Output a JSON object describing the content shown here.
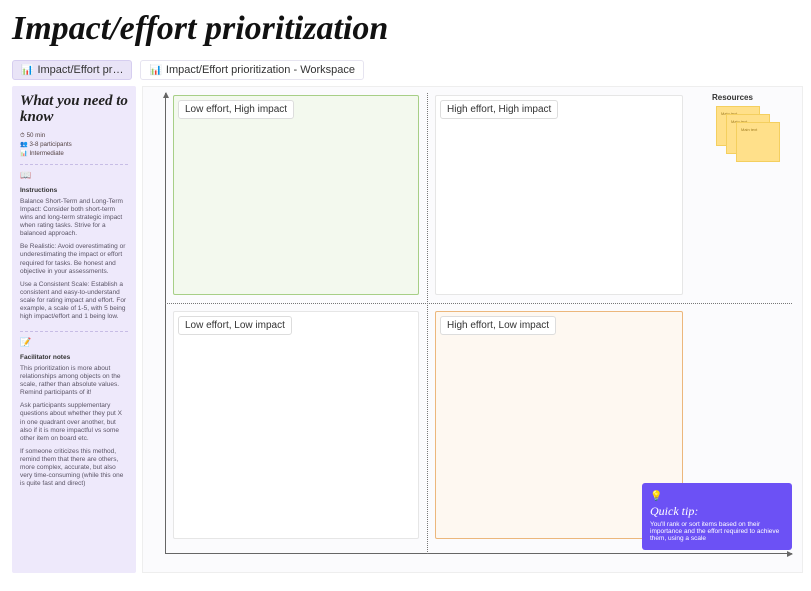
{
  "title": "Impact/effort prioritization",
  "tabs": {
    "short": "Impact/Effort pr…",
    "full": "Impact/Effort prioritization - Workspace"
  },
  "sidebar": {
    "heading": "What you need to know",
    "meta": {
      "duration": "50 min",
      "participants": "3-8 participants",
      "level": "Intermediate"
    },
    "icons": {
      "instructions": "📖",
      "facilitator": "📝"
    },
    "instructions_label": "Instructions",
    "instructions": [
      "Balance Short-Term and Long-Term Impact: Consider both short-term wins and long-term strategic impact when rating tasks. Strive for a balanced approach.",
      "Be Realistic: Avoid overestimating or underestimating the impact or effort required for tasks. Be honest and objective in your assessments.",
      "Use a Consistent Scale: Establish a consistent and easy-to-understand scale for rating impact and effort. For example, a scale of 1-5, with 5 being high impact/effort and 1 being low."
    ],
    "facilitator_label": "Facilitator notes",
    "facilitator": [
      "This prioritization is more about relationships among objects on the scale, rather than absolute values. Remind participants of it!",
      "Ask participants supplementary questions about whether they put X in one quadrant over another, but also if it is more impactful vs some other item on board etc.",
      "If someone criticizes this method, remind them that there are others, more complex, accurate, but also very time-consuming (while this one is quite fast and direct)"
    ]
  },
  "quadrants": {
    "tl": "Low effort, High impact",
    "tr": "High effort, High impact",
    "bl": "Low effort, Low impact",
    "br": "High effort, Low impact"
  },
  "resources": {
    "label": "Resources",
    "sticky_text": "Main text"
  },
  "tip": {
    "title": "Quick tip:",
    "body": "You'll rank or sort items based on their importance and the effort required to achieve them, using a scale"
  },
  "icons": {
    "clock": "⏱",
    "people": "👥",
    "level": "📊",
    "chart": "📊",
    "bulb": "💡"
  }
}
